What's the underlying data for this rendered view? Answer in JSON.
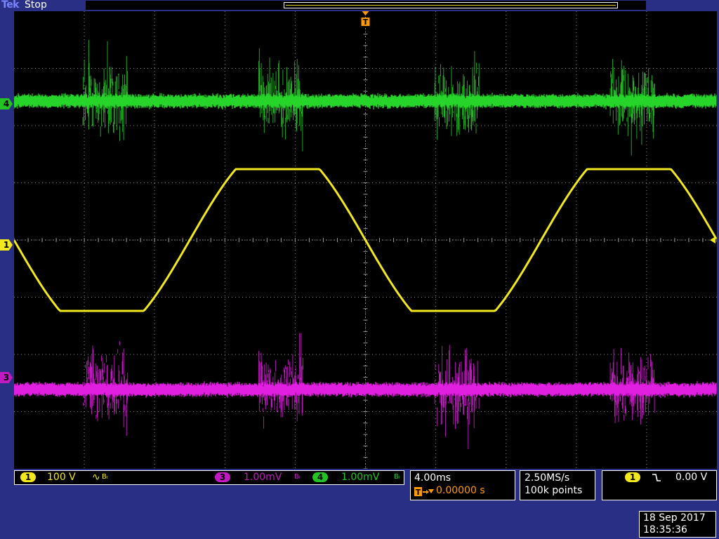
{
  "header": {
    "brand": "Tek",
    "status": "Stop",
    "trigger_marker": "T"
  },
  "channel_markers": {
    "ch4": "4",
    "ch1": "1",
    "ch3": "3"
  },
  "colors": {
    "ch1": "#f3e81d",
    "ch3": "#e11fe1",
    "ch4": "#27d42a",
    "trigger": "#ff9a00",
    "screen_bg": "#000000",
    "frame": "#2a2f86"
  },
  "channel_readout": {
    "ch1": {
      "label": "1",
      "scale": "100 V",
      "coupling": "∿",
      "bw": "Bₗ"
    },
    "ch3": {
      "label": "3",
      "scale": "1.00mV",
      "bw": "Bₗ"
    },
    "ch4": {
      "label": "4",
      "scale": "1.00mV",
      "bw": "Bₗ"
    }
  },
  "horizontal": {
    "scale": "4.00ms",
    "position": "0.00000 s"
  },
  "acquisition": {
    "sample_rate": "2.50MS/s",
    "record_length": "100k points"
  },
  "trigger": {
    "source": "1",
    "slope_icon": "falling-edge-icon",
    "level": "0.00 V"
  },
  "timestamp": {
    "date": "18 Sep  2017",
    "time": "18:35:36"
  },
  "chart_data": {
    "type": "line",
    "grid": true,
    "x_divisions": 10,
    "y_divisions": 8,
    "series": [
      {
        "name": "1",
        "shape": "clipped-sine",
        "periods_shown": 2.0
      },
      {
        "name": "4",
        "shape": "noise-with-bursts",
        "bursts": 4
      },
      {
        "name": "3",
        "shape": "noise-with-bursts",
        "bursts": 4
      }
    ]
  }
}
